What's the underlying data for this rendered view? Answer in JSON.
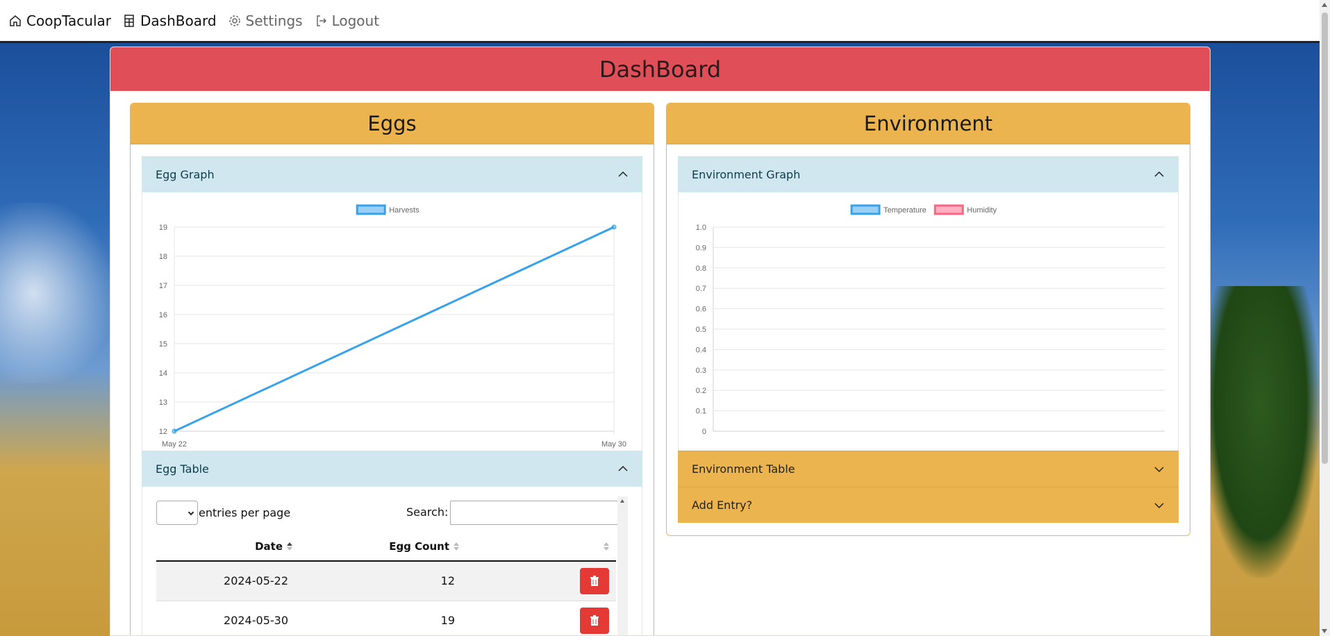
{
  "nav": {
    "brand": "CoopTacular",
    "dashboard": "DashBoard",
    "settings": "Settings",
    "logout": "Logout"
  },
  "page_title": "DashBoard",
  "eggs_panel": {
    "title": "Eggs",
    "graph_title": "Egg Graph",
    "table_title": "Egg Table",
    "table": {
      "per_page_value": "",
      "per_page_label": "entries per page",
      "search_label": "Search:",
      "search_value": "",
      "columns": [
        "Date",
        "Egg Count",
        ""
      ],
      "rows": [
        {
          "date": "2024-05-22",
          "count": "12"
        },
        {
          "date": "2024-05-30",
          "count": "19"
        }
      ]
    }
  },
  "environment_panel": {
    "title": "Environment",
    "graph_title": "Environment Graph",
    "table_title": "Environment Table",
    "add_entry_title": "Add Entry?"
  },
  "chart_data": [
    {
      "type": "line",
      "title": "",
      "x": [
        "May 22",
        "May 30"
      ],
      "series": [
        {
          "name": "Harvests",
          "values": [
            12,
            19
          ],
          "color": "#36a2eb"
        }
      ],
      "ylim": [
        12,
        19
      ],
      "yticks": [
        "19",
        "18",
        "17",
        "16",
        "15",
        "14",
        "13",
        "12"
      ],
      "legend": "top-center",
      "grid": true
    },
    {
      "type": "line",
      "title": "",
      "x": [],
      "series": [
        {
          "name": "Temperature",
          "values": [],
          "color": "#36a2eb"
        },
        {
          "name": "Humidity",
          "values": [],
          "color": "#ff6384"
        }
      ],
      "ylim": [
        0,
        1.0
      ],
      "yticks": [
        "1.0",
        "0.9",
        "0.8",
        "0.7",
        "0.6",
        "0.5",
        "0.4",
        "0.3",
        "0.2",
        "0.1",
        "0"
      ],
      "legend": "top-center",
      "grid": true
    }
  ],
  "colors": {
    "header_red": "#e04e58",
    "panel_gold": "#ecb44e",
    "accordion_blue": "#d1e7f0",
    "delete_red": "#e53935"
  }
}
